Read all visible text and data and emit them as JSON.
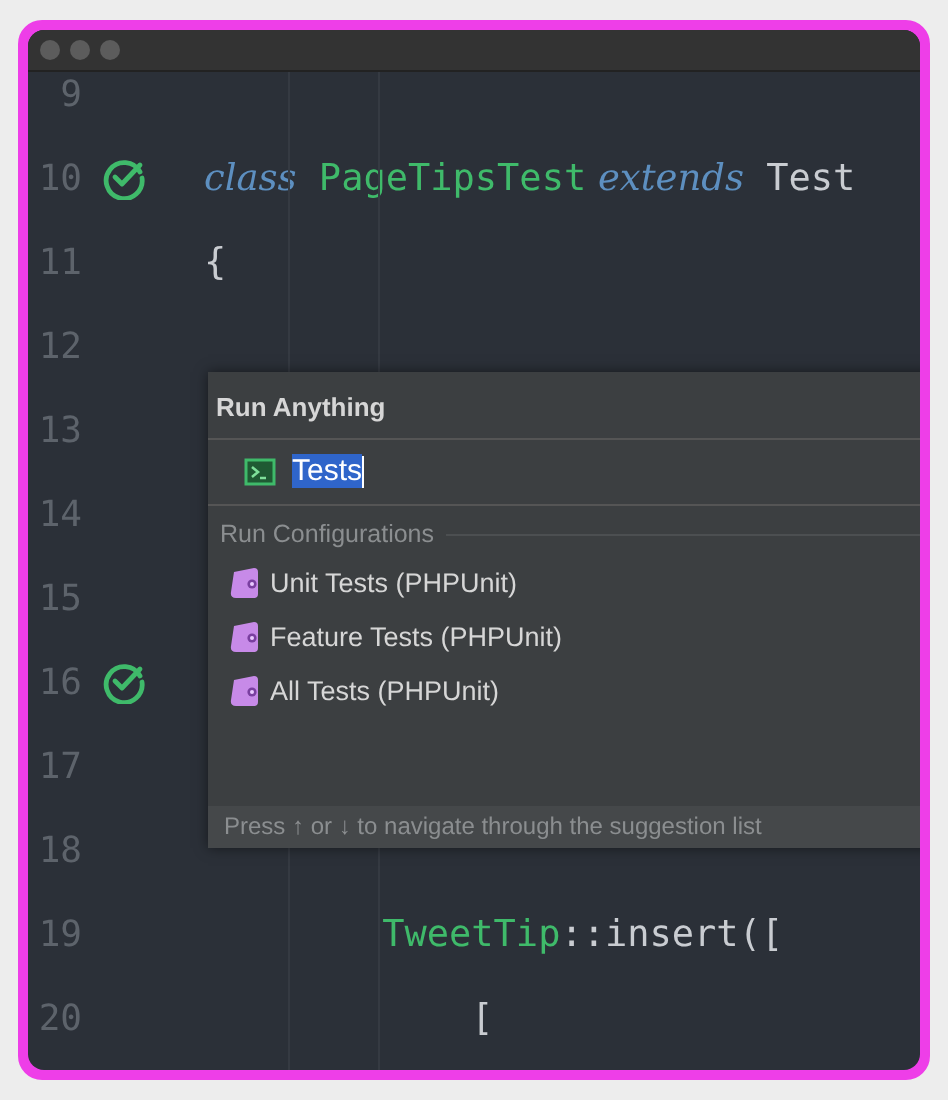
{
  "lines": [
    {
      "number": "9",
      "test_marker": false
    },
    {
      "number": "10",
      "test_marker": true,
      "tokens": [
        {
          "text": "class",
          "kind": "keyword"
        },
        {
          "text": " PageTipsTest",
          "kind": "type"
        },
        {
          "text": " extends",
          "kind": "keyword"
        },
        {
          "text": " Test",
          "kind": "plain"
        }
      ]
    },
    {
      "number": "11",
      "test_marker": false,
      "tokens": [
        {
          "text": "{",
          "kind": "plain"
        }
      ]
    },
    {
      "number": "12",
      "test_marker": false
    },
    {
      "number": "13",
      "test_marker": false
    },
    {
      "number": "14",
      "test_marker": false
    },
    {
      "number": "15",
      "test_marker": false
    },
    {
      "number": "16",
      "test_marker": true
    },
    {
      "number": "17",
      "test_marker": false
    },
    {
      "number": "18",
      "test_marker": false
    },
    {
      "number": "19",
      "test_marker": false,
      "tokens": [
        {
          "text": "        TweetTip",
          "kind": "type"
        },
        {
          "text": "::insert([",
          "kind": "plain"
        }
      ]
    },
    {
      "number": "20",
      "test_marker": false,
      "tokens": [
        {
          "text": "            [",
          "kind": "plain"
        }
      ]
    }
  ],
  "popup": {
    "title": "Run Anything",
    "query": "Tests",
    "section": "Run Configurations",
    "items": [
      {
        "label": "Unit Tests (PHPUnit)"
      },
      {
        "label": "Feature Tests (PHPUnit)"
      },
      {
        "label": "All Tests (PHPUnit)"
      }
    ],
    "hint": "Press ↑ or ↓ to navigate through the suggestion list"
  }
}
